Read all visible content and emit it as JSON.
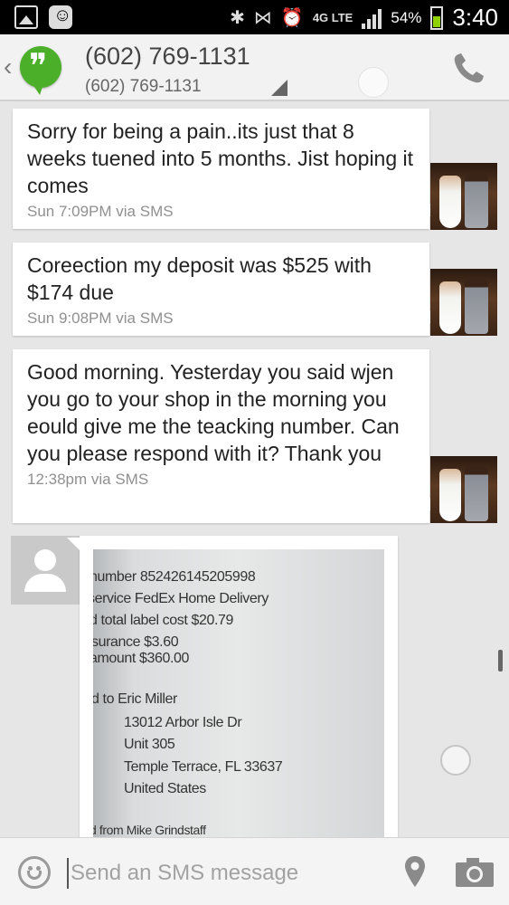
{
  "status_bar": {
    "battery": "54%",
    "time": "3:40",
    "network": "4G LTE",
    "left_icons": [
      "gallery-icon",
      "messenger-icon"
    ],
    "right_icons": [
      "bluetooth-icon",
      "nfc-icon",
      "alarm-icon",
      "signal-icon",
      "battery-icon"
    ]
  },
  "header": {
    "contact_name": "(602) 769-1131",
    "contact_number": "(602) 769-1131",
    "app_icon": "hangouts-logo-icon",
    "call_icon": "phone-icon"
  },
  "messages": [
    {
      "text": "Sorry for being a pain..its just that 8 weeks tuened into 5 months. Jist hoping it comes",
      "meta": "Sun 7:09PM via SMS",
      "direction": "outgoing"
    },
    {
      "text": "Coreection my deposit was $525 with $174 due",
      "meta": "Sun 9:08PM via SMS",
      "direction": "outgoing"
    },
    {
      "text": "Good morning. Yesterday you said wjen you go to your shop in the morning you eould give me the teacking number. Can you please respond with it? Thank you",
      "meta": "12:38pm via SMS",
      "direction": "outgoing"
    }
  ],
  "incoming_image": {
    "lines": [
      "number  852426145205998",
      "service  FedEx Home Delivery",
      "d total label cost  $20.79",
      "surance  $3.60",
      "amount  $360.00",
      "d to  Eric Miller",
      "13012 Arbor Isle Dr",
      "Unit 305",
      "Temple Terrace, FL 33637",
      "United States",
      "d from  Mike Grindstaff"
    ]
  },
  "compose": {
    "placeholder": "Send an SMS message",
    "emoji_icon": "smiley-icon",
    "location_icon": "location-pin-icon",
    "camera_icon": "camera-icon"
  },
  "colors": {
    "accent_green": "#4caf2a",
    "background": "#e6e6e6",
    "bubble": "#ffffff",
    "meta_text": "#909090"
  }
}
